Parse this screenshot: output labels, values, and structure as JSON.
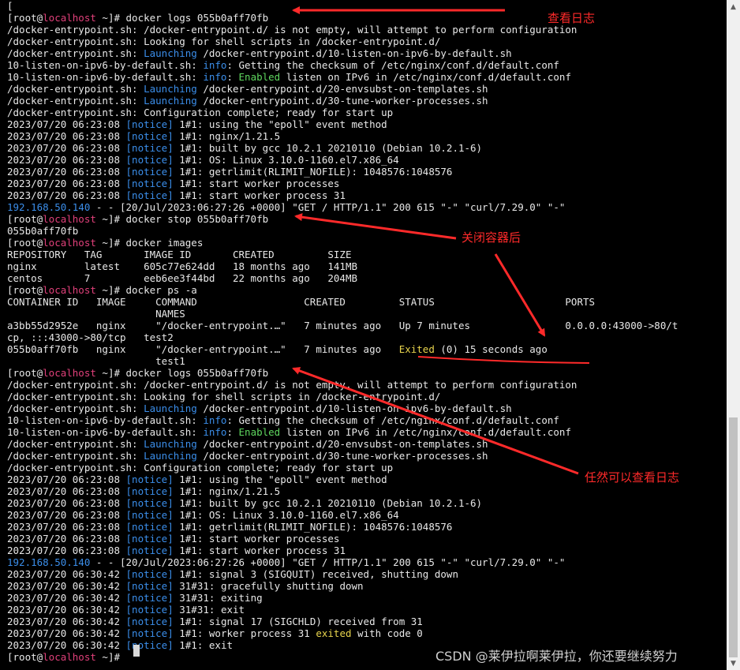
{
  "colors": {
    "background": "#000000",
    "text": "#e8e8e8",
    "hostname": "#e0407a",
    "keyword_blue": "#3b8eea",
    "enabled_green": "#5fd75f",
    "status_yellow": "#e8d44d",
    "annotation_red": "#ff2a2a"
  },
  "terminal": {
    "lines": [
      [
        [
          "n",
          "["
        ]
      ],
      [
        [
          "n",
          "[root@"
        ],
        [
          "h",
          "localhost"
        ],
        [
          "n",
          " ~]# docker logs 055b0aff70fb"
        ]
      ],
      [
        [
          "n",
          "/docker-entrypoint.sh: /docker-entrypoint.d/ is not empty, will attempt to perform configuration"
        ]
      ],
      [
        [
          "n",
          "/docker-entrypoint.sh: Looking for shell scripts in /docker-entrypoint.d/"
        ]
      ],
      [
        [
          "n",
          "/docker-entrypoint.sh: "
        ],
        [
          "b",
          "Launching"
        ],
        [
          "n",
          " /docker-entrypoint.d/10-listen-on-ipv6-by-default.sh"
        ]
      ],
      [
        [
          "n",
          "10-listen-on-ipv6-by-default.sh: "
        ],
        [
          "b",
          "info"
        ],
        [
          "n",
          ": Getting the checksum of /etc/nginx/conf.d/default.conf"
        ]
      ],
      [
        [
          "n",
          "10-listen-on-ipv6-by-default.sh: "
        ],
        [
          "b",
          "info"
        ],
        [
          "n",
          ": "
        ],
        [
          "g",
          "Enabled"
        ],
        [
          "n",
          " listen on IPv6 in /etc/nginx/conf.d/default.conf"
        ]
      ],
      [
        [
          "n",
          "/docker-entrypoint.sh: "
        ],
        [
          "b",
          "Launching"
        ],
        [
          "n",
          " /docker-entrypoint.d/20-envsubst-on-templates.sh"
        ]
      ],
      [
        [
          "n",
          "/docker-entrypoint.sh: "
        ],
        [
          "b",
          "Launching"
        ],
        [
          "n",
          " /docker-entrypoint.d/30-tune-worker-processes.sh"
        ]
      ],
      [
        [
          "n",
          "/docker-entrypoint.sh: Configuration complete; ready for start up"
        ]
      ],
      [
        [
          "n",
          "2023/07/20 06:23:08 "
        ],
        [
          "b",
          "[notice]"
        ],
        [
          "n",
          " 1#1: using the \"epoll\" event method"
        ]
      ],
      [
        [
          "n",
          "2023/07/20 06:23:08 "
        ],
        [
          "b",
          "[notice]"
        ],
        [
          "n",
          " 1#1: nginx/1.21.5"
        ]
      ],
      [
        [
          "n",
          "2023/07/20 06:23:08 "
        ],
        [
          "b",
          "[notice]"
        ],
        [
          "n",
          " 1#1: built by gcc 10.2.1 20210110 (Debian 10.2.1-6)"
        ]
      ],
      [
        [
          "n",
          "2023/07/20 06:23:08 "
        ],
        [
          "b",
          "[notice]"
        ],
        [
          "n",
          " 1#1: OS: Linux 3.10.0-1160.el7.x86_64"
        ]
      ],
      [
        [
          "n",
          "2023/07/20 06:23:08 "
        ],
        [
          "b",
          "[notice]"
        ],
        [
          "n",
          " 1#1: getrlimit(RLIMIT_NOFILE): 1048576:1048576"
        ]
      ],
      [
        [
          "n",
          "2023/07/20 06:23:08 "
        ],
        [
          "b",
          "[notice]"
        ],
        [
          "n",
          " 1#1: start worker processes"
        ]
      ],
      [
        [
          "n",
          "2023/07/20 06:23:08 "
        ],
        [
          "b",
          "[notice]"
        ],
        [
          "n",
          " 1#1: start worker process 31"
        ]
      ],
      [
        [
          "b",
          "192.168.50.140"
        ],
        [
          "n",
          " - - [20/Jul/2023:06:27:26 +0000] \"GET / HTTP/1.1\" 200 615 \"-\" \"curl/7.29.0\" \"-\""
        ]
      ],
      [
        [
          "n",
          "[root@"
        ],
        [
          "h",
          "localhost"
        ],
        [
          "n",
          " ~]# docker stop 055b0aff70fb"
        ]
      ],
      [
        [
          "n",
          "055b0aff70fb"
        ]
      ],
      [
        [
          "n",
          "[root@"
        ],
        [
          "h",
          "localhost"
        ],
        [
          "n",
          " ~]# docker images"
        ]
      ],
      [
        [
          "n",
          "REPOSITORY   TAG       IMAGE ID       CREATED         SIZE"
        ]
      ],
      [
        [
          "n",
          "nginx        latest    605c77e624dd   18 months ago   141MB"
        ]
      ],
      [
        [
          "n",
          "centos       7         eeb6ee3f44bd   22 months ago   204MB"
        ]
      ],
      [
        [
          "n",
          "[root@"
        ],
        [
          "h",
          "localhost"
        ],
        [
          "n",
          " ~]# docker ps -a"
        ]
      ],
      [
        [
          "n",
          "CONTAINER ID   IMAGE     COMMAND                  CREATED         STATUS                      PORTS"
        ]
      ],
      [
        [
          "n",
          "                         NAMES"
        ]
      ],
      [
        [
          "n",
          "a3bb55d2952e   nginx     \"/docker-entrypoint.…\"   7 minutes ago   Up 7 minutes                0.0.0.0:43000->80/t"
        ]
      ],
      [
        [
          "n",
          "cp, :::43000->80/tcp   test2"
        ]
      ],
      [
        [
          "n",
          "055b0aff70fb   nginx     \"/docker-entrypoint.…\"   7 minutes ago   "
        ],
        [
          "y",
          "Exited"
        ],
        [
          "n",
          " (0) 15 seconds ago"
        ]
      ],
      [
        [
          "n",
          "                         test1"
        ]
      ],
      [
        [
          "n",
          "[root@"
        ],
        [
          "h",
          "localhost"
        ],
        [
          "n",
          " ~]# docker logs 055b0aff70fb"
        ]
      ],
      [
        [
          "n",
          "/docker-entrypoint.sh: /docker-entrypoint.d/ is not empty, will attempt to perform configuration"
        ]
      ],
      [
        [
          "n",
          "/docker-entrypoint.sh: Looking for shell scripts in /docker-entrypoint.d/"
        ]
      ],
      [
        [
          "n",
          "/docker-entrypoint.sh: "
        ],
        [
          "b",
          "Launching"
        ],
        [
          "n",
          " /docker-entrypoint.d/10-listen-on-ipv6-by-default.sh"
        ]
      ],
      [
        [
          "n",
          "10-listen-on-ipv6-by-default.sh: "
        ],
        [
          "b",
          "info"
        ],
        [
          "n",
          ": Getting the checksum of /etc/nginx/conf.d/default.conf"
        ]
      ],
      [
        [
          "n",
          "10-listen-on-ipv6-by-default.sh: "
        ],
        [
          "b",
          "info"
        ],
        [
          "n",
          ": "
        ],
        [
          "g",
          "Enabled"
        ],
        [
          "n",
          " listen on IPv6 in /etc/nginx/conf.d/default.conf"
        ]
      ],
      [
        [
          "n",
          "/docker-entrypoint.sh: "
        ],
        [
          "b",
          "Launching"
        ],
        [
          "n",
          " /docker-entrypoint.d/20-envsubst-on-templates.sh"
        ]
      ],
      [
        [
          "n",
          "/docker-entrypoint.sh: "
        ],
        [
          "b",
          "Launching"
        ],
        [
          "n",
          " /docker-entrypoint.d/30-tune-worker-processes.sh"
        ]
      ],
      [
        [
          "n",
          "/docker-entrypoint.sh: Configuration complete; ready for start up"
        ]
      ],
      [
        [
          "n",
          "2023/07/20 06:23:08 "
        ],
        [
          "b",
          "[notice]"
        ],
        [
          "n",
          " 1#1: using the \"epoll\" event method"
        ]
      ],
      [
        [
          "n",
          "2023/07/20 06:23:08 "
        ],
        [
          "b",
          "[notice]"
        ],
        [
          "n",
          " 1#1: nginx/1.21.5"
        ]
      ],
      [
        [
          "n",
          "2023/07/20 06:23:08 "
        ],
        [
          "b",
          "[notice]"
        ],
        [
          "n",
          " 1#1: built by gcc 10.2.1 20210110 (Debian 10.2.1-6)"
        ]
      ],
      [
        [
          "n",
          "2023/07/20 06:23:08 "
        ],
        [
          "b",
          "[notice]"
        ],
        [
          "n",
          " 1#1: OS: Linux 3.10.0-1160.el7.x86_64"
        ]
      ],
      [
        [
          "n",
          "2023/07/20 06:23:08 "
        ],
        [
          "b",
          "[notice]"
        ],
        [
          "n",
          " 1#1: getrlimit(RLIMIT_NOFILE): 1048576:1048576"
        ]
      ],
      [
        [
          "n",
          "2023/07/20 06:23:08 "
        ],
        [
          "b",
          "[notice]"
        ],
        [
          "n",
          " 1#1: start worker processes"
        ]
      ],
      [
        [
          "n",
          "2023/07/20 06:23:08 "
        ],
        [
          "b",
          "[notice]"
        ],
        [
          "n",
          " 1#1: start worker process 31"
        ]
      ],
      [
        [
          "b",
          "192.168.50.140"
        ],
        [
          "n",
          " - - [20/Jul/2023:06:27:26 +0000] \"GET / HTTP/1.1\" 200 615 \"-\" \"curl/7.29.0\" \"-\""
        ]
      ],
      [
        [
          "n",
          "2023/07/20 06:30:42 "
        ],
        [
          "b",
          "[notice]"
        ],
        [
          "n",
          " 1#1: signal 3 (SIGQUIT) received, shutting down"
        ]
      ],
      [
        [
          "n",
          "2023/07/20 06:30:42 "
        ],
        [
          "b",
          "[notice]"
        ],
        [
          "n",
          " 31#31: gracefully shutting down"
        ]
      ],
      [
        [
          "n",
          "2023/07/20 06:30:42 "
        ],
        [
          "b",
          "[notice]"
        ],
        [
          "n",
          " 31#31: exiting"
        ]
      ],
      [
        [
          "n",
          "2023/07/20 06:30:42 "
        ],
        [
          "b",
          "[notice]"
        ],
        [
          "n",
          " 31#31: exit"
        ]
      ],
      [
        [
          "n",
          "2023/07/20 06:30:42 "
        ],
        [
          "b",
          "[notice]"
        ],
        [
          "n",
          " 1#1: signal 17 (SIGCHLD) received from 31"
        ]
      ],
      [
        [
          "n",
          "2023/07/20 06:30:42 "
        ],
        [
          "b",
          "[notice]"
        ],
        [
          "n",
          " 1#1: worker process 31 "
        ],
        [
          "y",
          "exited"
        ],
        [
          "n",
          " with code 0"
        ]
      ],
      [
        [
          "n",
          "2023/07/20 06:30:42 "
        ],
        [
          "b",
          "[notice]"
        ],
        [
          "n",
          " 1#1: exit"
        ]
      ],
      [
        [
          "n",
          "[root@"
        ],
        [
          "h",
          "localhost"
        ],
        [
          "n",
          " ~]# "
        ]
      ]
    ]
  },
  "annotations": {
    "view_logs": "查看日志",
    "after_stop": "关闭容器后",
    "still_view": "任然可以查看日志"
  },
  "scrollbar": {
    "up_icon": "▲",
    "down_icon": "▼"
  },
  "watermark": "CSDN @莱伊拉啊莱伊拉，你还要继续努力"
}
